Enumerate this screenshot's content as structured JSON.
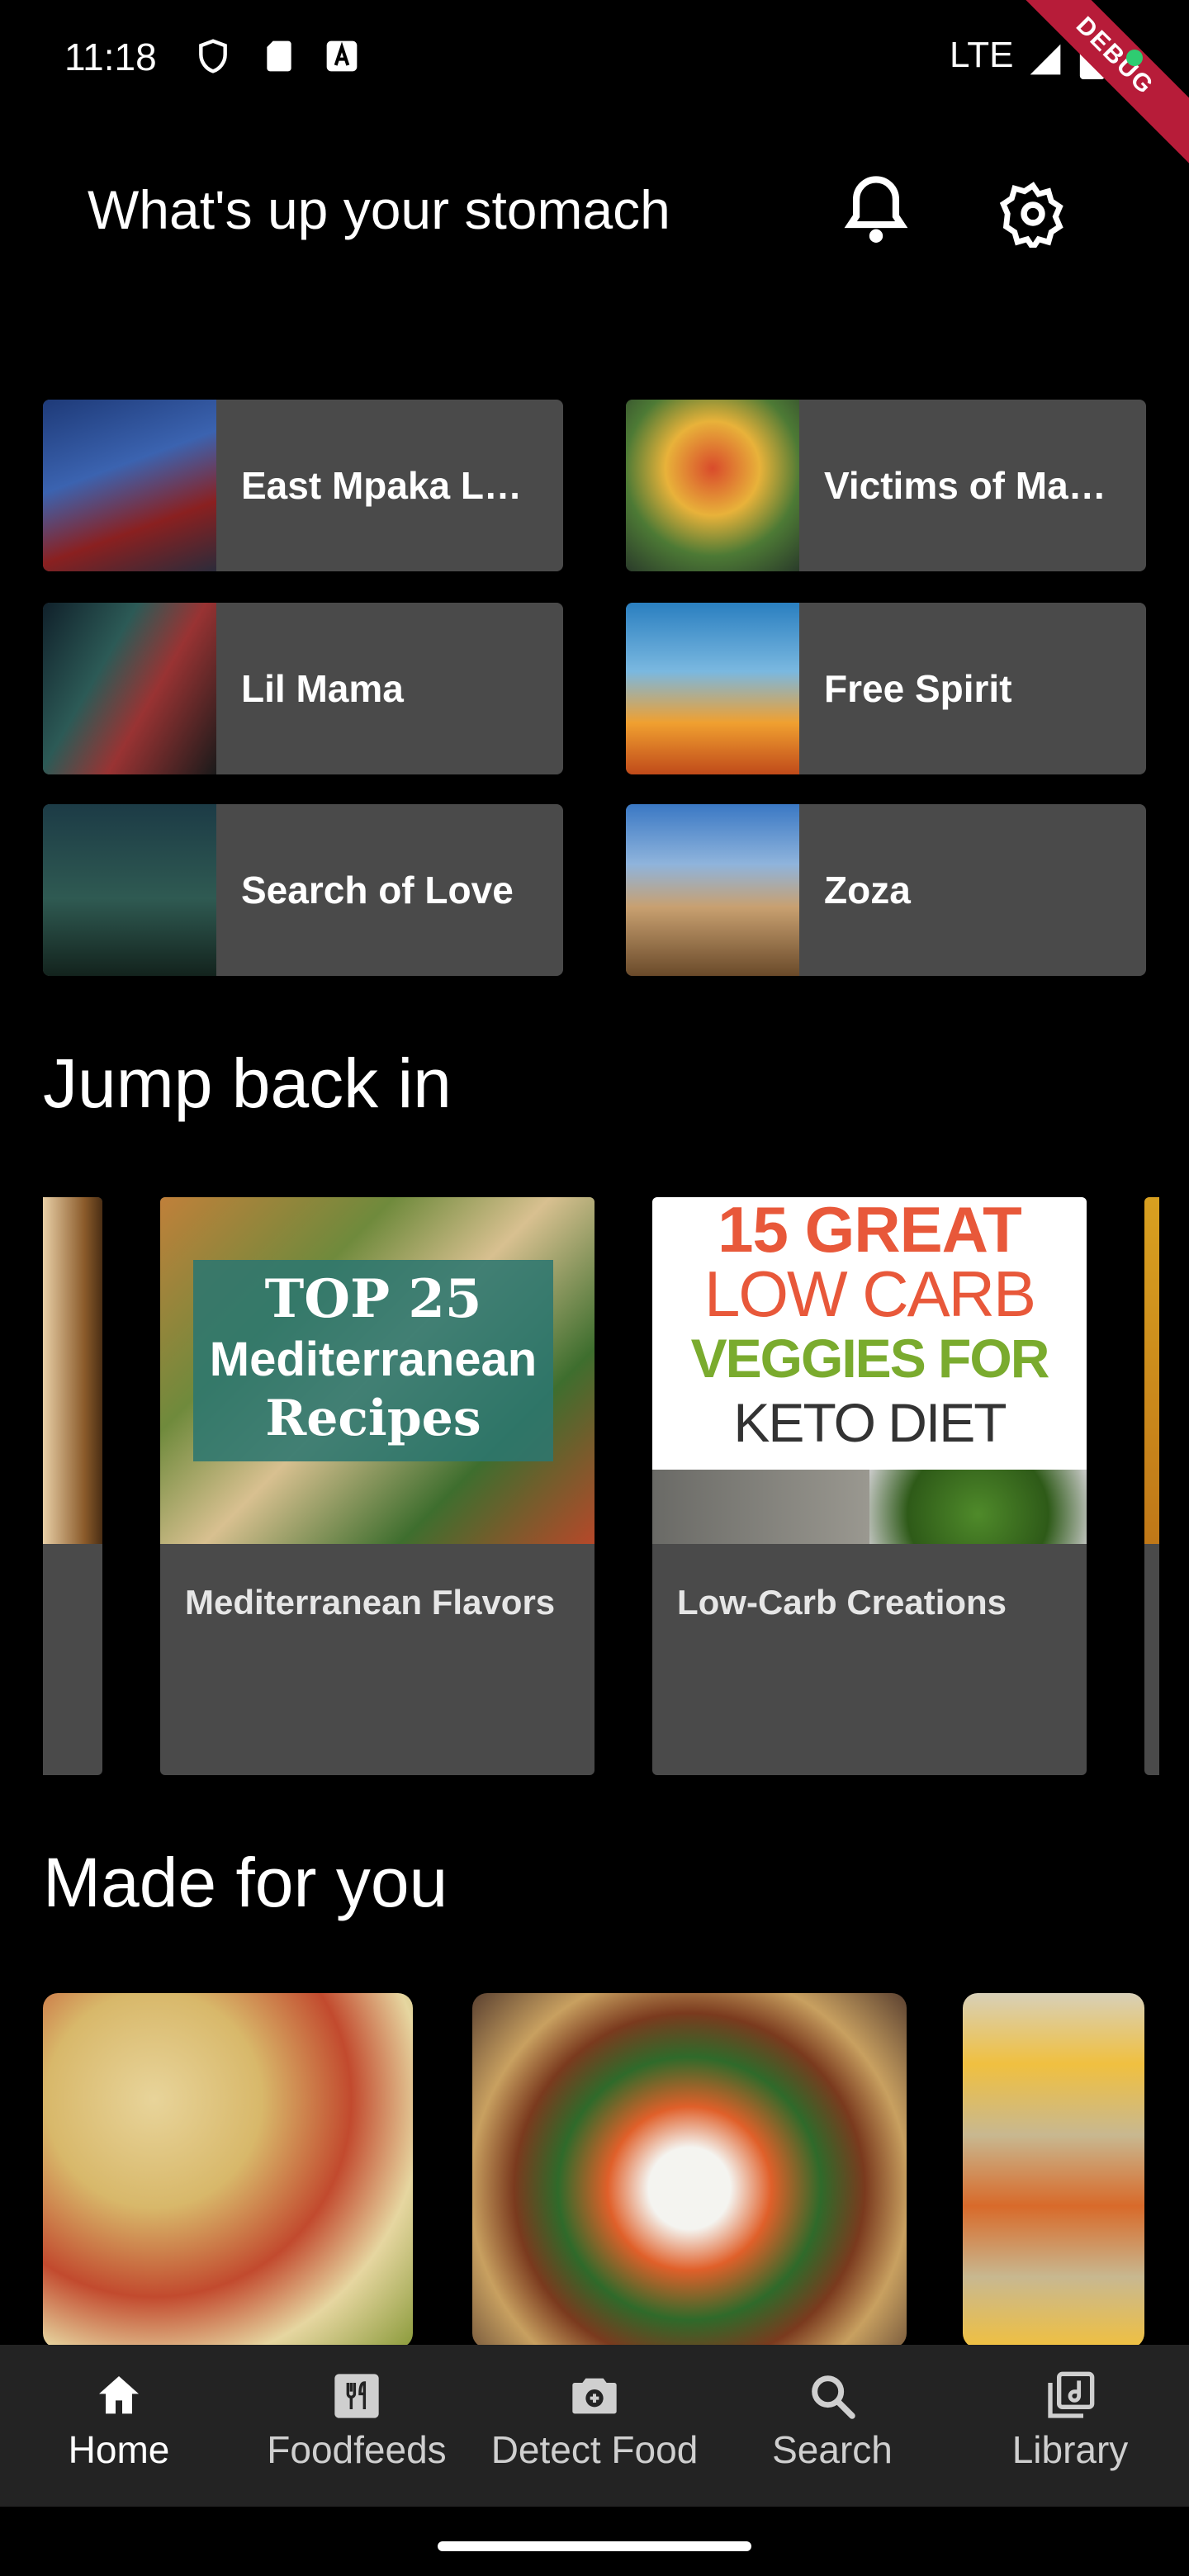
{
  "status_bar": {
    "time": "11:18",
    "network": "LTE",
    "debug_label": "DEBUG"
  },
  "header": {
    "title": "What's up your stomach",
    "bell_icon": "bell-icon",
    "settings_icon": "gear-icon"
  },
  "quick_tiles": [
    {
      "label": "East Mpaka London"
    },
    {
      "label": "Victims of Madness"
    },
    {
      "label": "Lil Mama"
    },
    {
      "label": "Free Spirit"
    },
    {
      "label": "Search of Love"
    },
    {
      "label": "Zoza"
    }
  ],
  "jump_back_in": {
    "title": "Jump back in",
    "cards": [
      {
        "label": "Mediterranean Flavors",
        "thumb_lines": [
          "TOP 25",
          "Mediterranean",
          "Recipes"
        ]
      },
      {
        "label": "Low-Carb Creations",
        "thumb_lines": [
          "15 GREAT",
          "LOW CARB",
          "VEGGIES FOR",
          "KETO DIET"
        ]
      }
    ]
  },
  "made_for_you": {
    "title": "Made for you"
  },
  "bottom_nav": {
    "items": [
      {
        "label": "Home",
        "icon": "home-icon",
        "active": true
      },
      {
        "label": "Foodfeeds",
        "icon": "restaurant-icon"
      },
      {
        "label": "Detect Food",
        "icon": "camera-icon"
      },
      {
        "label": "Search",
        "icon": "search-icon"
      },
      {
        "label": "Library",
        "icon": "library-icon"
      }
    ]
  },
  "colors": {
    "background": "#000000",
    "tile_bg": "#4a4a4a",
    "nav_bg": "#232323",
    "debug": "#b71c39"
  }
}
